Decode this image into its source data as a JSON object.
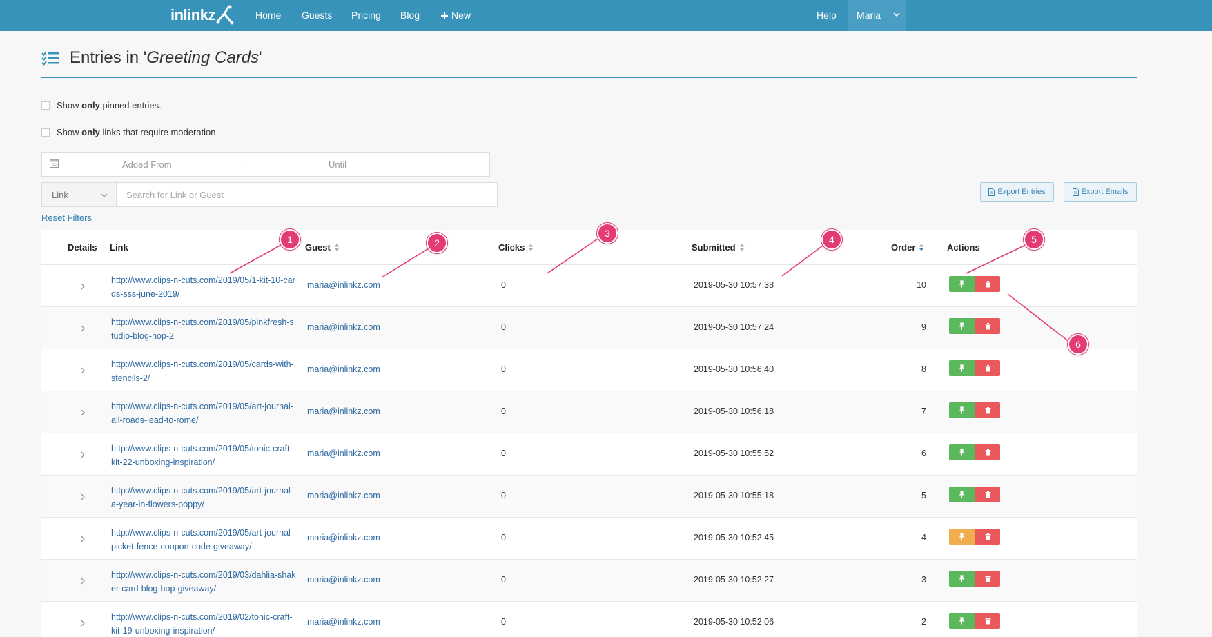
{
  "navbar": {
    "logo": "inlinkz",
    "links": [
      "Home",
      "Guests",
      "Pricing",
      "Blog",
      "New"
    ],
    "help": "Help",
    "user": "Maria"
  },
  "header": {
    "title_prefix": "Entries in '",
    "title_name": "Greeting Cards",
    "title_suffix": "'"
  },
  "filters": {
    "pinned": {
      "pre": "Show ",
      "bold": "only",
      "post": " pinned entries."
    },
    "moderation": {
      "pre": "Show ",
      "bold": "only",
      "post": " links that require moderation"
    },
    "added_from": "Added From",
    "date_sep": "-",
    "until": "Until",
    "search_type": "Link",
    "search_placeholder": "Search for Link or Guest",
    "reset": "Reset Filters"
  },
  "export": {
    "entries": "Export Entries",
    "emails": "Export Emails"
  },
  "table": {
    "columns": [
      "Details",
      "Link",
      "Guest",
      "Clicks",
      "Submitted",
      "Order",
      "Actions"
    ],
    "rows": [
      {
        "link": "http://www.clips-n-cuts.com/2019/05/1-kit-10-cards-sss-june-2019/",
        "guest": "maria@inlinkz.com",
        "clicks": "0",
        "submitted": "2019-05-30 10:57:38",
        "order": "10",
        "pin_state": "normal"
      },
      {
        "link": "http://www.clips-n-cuts.com/2019/05/pinkfresh-studio-blog-hop-2",
        "guest": "maria@inlinkz.com",
        "clicks": "0",
        "submitted": "2019-05-30 10:57:24",
        "order": "9",
        "pin_state": "normal"
      },
      {
        "link": "http://www.clips-n-cuts.com/2019/05/cards-with-stencils-2/",
        "guest": "maria@inlinkz.com",
        "clicks": "0",
        "submitted": "2019-05-30 10:56:40",
        "order": "8",
        "pin_state": "normal"
      },
      {
        "link": "http://www.clips-n-cuts.com/2019/05/art-journal-all-roads-lead-to-rome/",
        "guest": "maria@inlinkz.com",
        "clicks": "0",
        "submitted": "2019-05-30 10:56:18",
        "order": "7",
        "pin_state": "normal"
      },
      {
        "link": "http://www.clips-n-cuts.com/2019/05/tonic-craft-kit-22-unboxing-inspiration/",
        "guest": "maria@inlinkz.com",
        "clicks": "0",
        "submitted": "2019-05-30 10:55:52",
        "order": "6",
        "pin_state": "normal"
      },
      {
        "link": "http://www.clips-n-cuts.com/2019/05/art-journal-a-year-in-flowers-poppy/",
        "guest": "maria@inlinkz.com",
        "clicks": "0",
        "submitted": "2019-05-30 10:55:18",
        "order": "5",
        "pin_state": "normal"
      },
      {
        "link": "http://www.clips-n-cuts.com/2019/05/art-journal-picket-fence-coupon-code-giveaway/",
        "guest": "maria@inlinkz.com",
        "clicks": "0",
        "submitted": "2019-05-30 10:52:45",
        "order": "4",
        "pin_state": "warning"
      },
      {
        "link": "http://www.clips-n-cuts.com/2019/03/dahlia-shaker-card-blog-hop-giveaway/",
        "guest": "maria@inlinkz.com",
        "clicks": "0",
        "submitted": "2019-05-30 10:52:27",
        "order": "3",
        "pin_state": "normal"
      },
      {
        "link": "http://www.clips-n-cuts.com/2019/02/tonic-craft-kit-19-unboxing-inspiration/",
        "guest": "maria@inlinkz.com",
        "clicks": "0",
        "submitted": "2019-05-30 10:52:06",
        "order": "2",
        "pin_state": "normal"
      }
    ]
  },
  "annotations": [
    "1",
    "2",
    "3",
    "4",
    "5",
    "6"
  ],
  "colors": {
    "navbar": "#3793b9",
    "pin": "#5cb85c",
    "pin_warning": "#f0ad4e",
    "delete": "#e9585a",
    "marker": "#e23c72"
  }
}
